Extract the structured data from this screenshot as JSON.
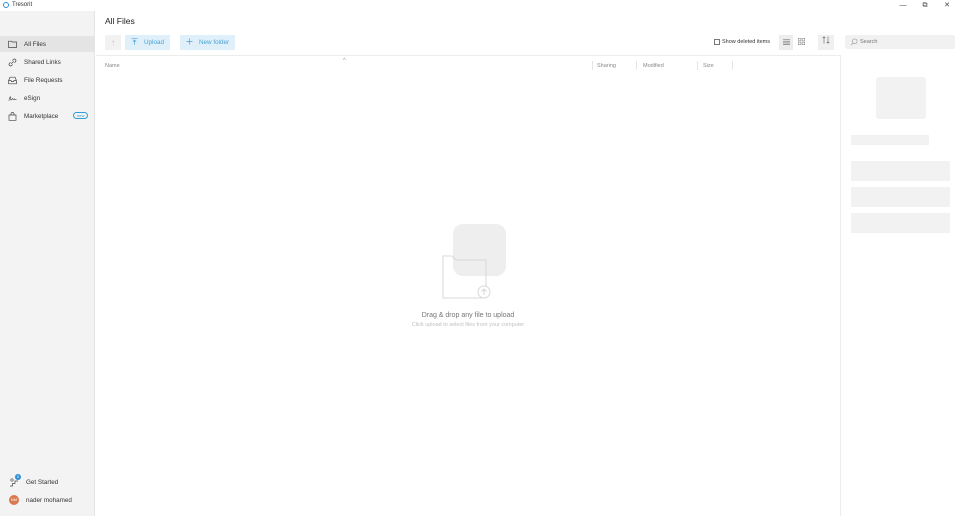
{
  "window": {
    "app_title": "Tresorit",
    "minimize_glyph": "—",
    "restore_glyph": "⧉",
    "close_glyph": "✕"
  },
  "sidebar": {
    "items": [
      {
        "label": "All Files",
        "icon": "folder-icon",
        "active": true
      },
      {
        "label": "Shared Links",
        "icon": "link-icon"
      },
      {
        "label": "File Requests",
        "icon": "inbox-icon"
      },
      {
        "label": "eSign",
        "icon": "signature-icon"
      },
      {
        "label": "Marketplace",
        "icon": "shopping-bag-icon",
        "badge": "new"
      }
    ],
    "bottom": {
      "get_started": {
        "label": "Get Started",
        "notification_count": "0"
      },
      "user": {
        "name": "nader mohamed",
        "initials": "NM"
      }
    }
  },
  "main": {
    "title": "All Files",
    "toolbar": {
      "up_glyph": "↑",
      "upload_label": "Upload",
      "new_folder_label": "New folder",
      "show_deleted_label": "Show deleted items",
      "search_placeholder": "Search"
    },
    "table": {
      "columns": [
        "Name",
        "Sharing",
        "Modified",
        "Size"
      ],
      "sort_indicator": "^"
    },
    "empty_state": {
      "title": "Drag & drop any file to upload",
      "subtitle": "Click upload to select files from your computer"
    }
  },
  "colors": {
    "accent": "#2f8fd5",
    "button_bg": "#dff0fa",
    "sidebar_bg": "#f3f3f3",
    "avatar": "#d9794e"
  }
}
